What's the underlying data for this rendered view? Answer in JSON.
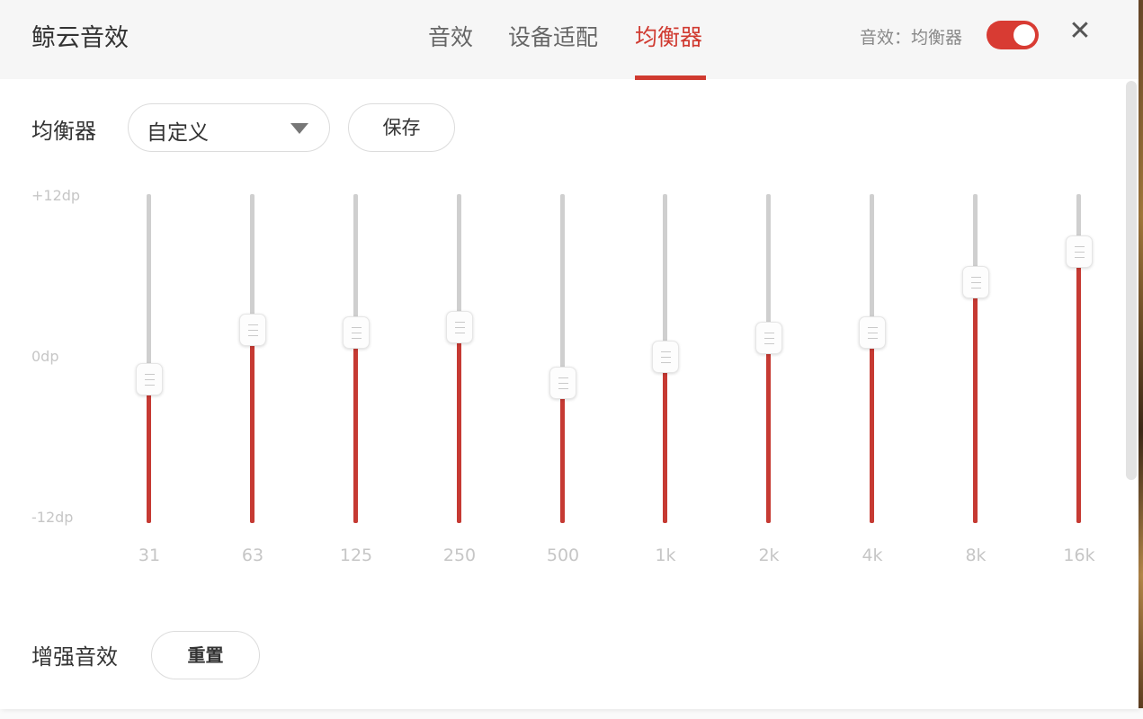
{
  "app": {
    "title": "鲸云音效"
  },
  "tabs": [
    {
      "label": "音效",
      "active": false
    },
    {
      "label": "设备适配",
      "active": false
    },
    {
      "label": "均衡器",
      "active": true
    }
  ],
  "header": {
    "status_label": "音效：均衡器",
    "toggle_on": true,
    "close_symbol": "✕"
  },
  "equalizer": {
    "label": "均衡器",
    "preset_value": "自定义",
    "save_label": "保存",
    "db_labels": {
      "max": "+12dp",
      "zero": "0dp",
      "min": "-12dp"
    },
    "range": [
      -12,
      12
    ],
    "bands": [
      {
        "freq": "31",
        "gain": -1.5
      },
      {
        "freq": "63",
        "gain": 2.1
      },
      {
        "freq": "125",
        "gain": 1.9
      },
      {
        "freq": "250",
        "gain": 2.3
      },
      {
        "freq": "500",
        "gain": -1.8
      },
      {
        "freq": "1k",
        "gain": 0.1
      },
      {
        "freq": "2k",
        "gain": 1.5
      },
      {
        "freq": "4k",
        "gain": 1.9
      },
      {
        "freq": "8k",
        "gain": 5.6
      },
      {
        "freq": "16k",
        "gain": 7.8
      }
    ]
  },
  "enhance": {
    "label": "增强音效",
    "reset_label": "重置"
  },
  "colors": {
    "accent": "#d03a30",
    "fill": "#c63a33",
    "track": "#cfcfcf"
  }
}
